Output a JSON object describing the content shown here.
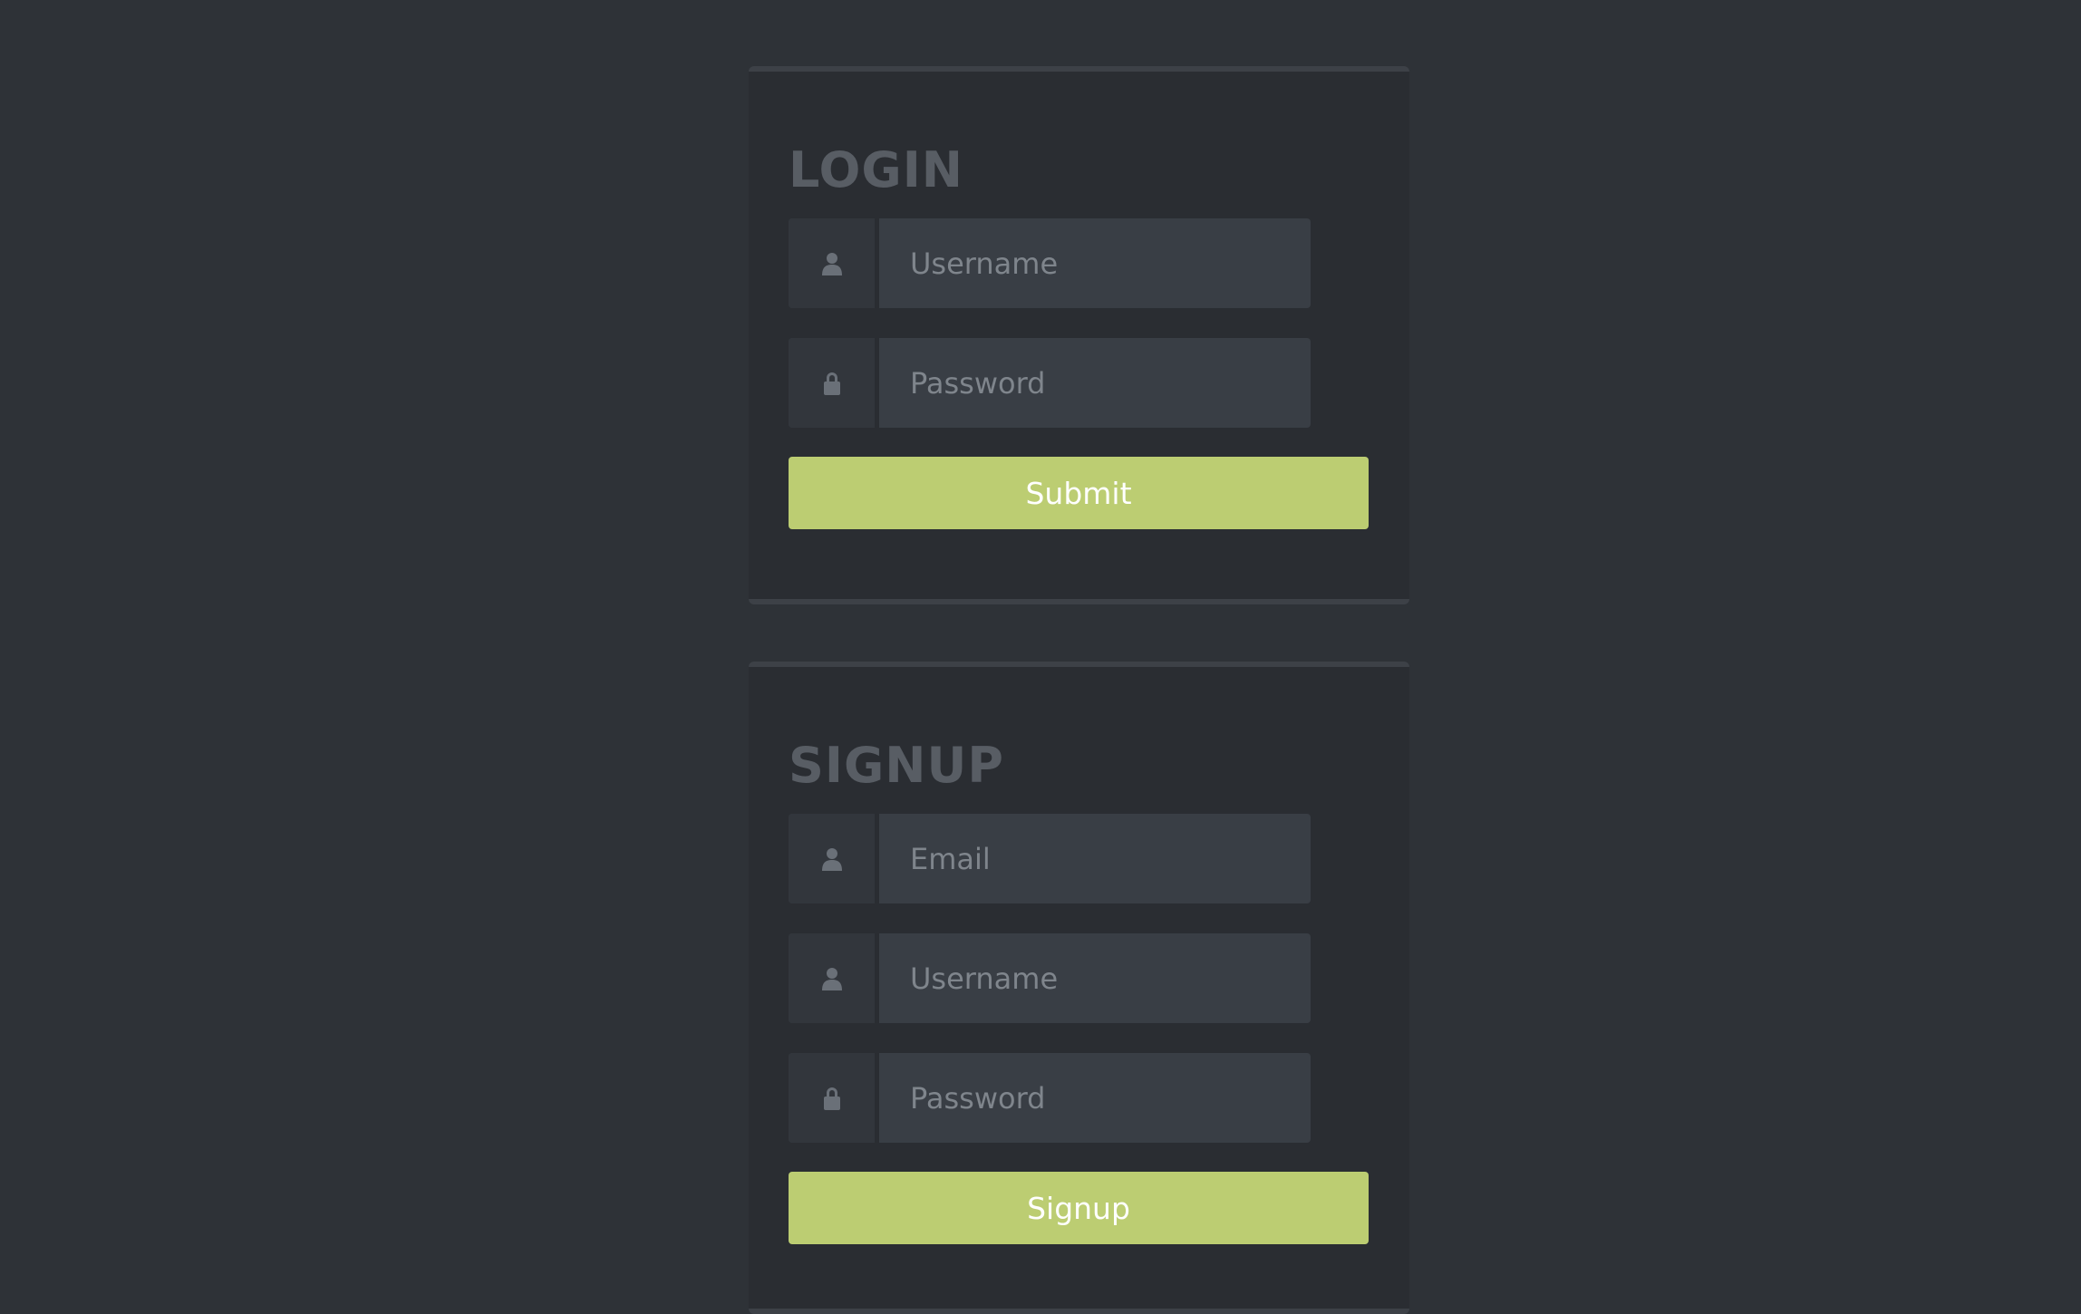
{
  "login": {
    "title": "LOGIN",
    "fields": [
      {
        "icon": "user-icon",
        "placeholder": "Username",
        "value": ""
      },
      {
        "icon": "lock-icon",
        "placeholder": "Password",
        "value": ""
      }
    ],
    "submit_label": "Submit"
  },
  "signup": {
    "title": "SIGNUP",
    "fields": [
      {
        "icon": "user-icon",
        "placeholder": "Email",
        "value": ""
      },
      {
        "icon": "user-icon",
        "placeholder": "Username",
        "value": ""
      },
      {
        "icon": "lock-icon",
        "placeholder": "Password",
        "value": ""
      }
    ],
    "submit_label": "Signup"
  },
  "colors": {
    "background": "#2e3237",
    "panel": "#2a2d32",
    "accent": "#bccd72",
    "title": "#585d64"
  }
}
